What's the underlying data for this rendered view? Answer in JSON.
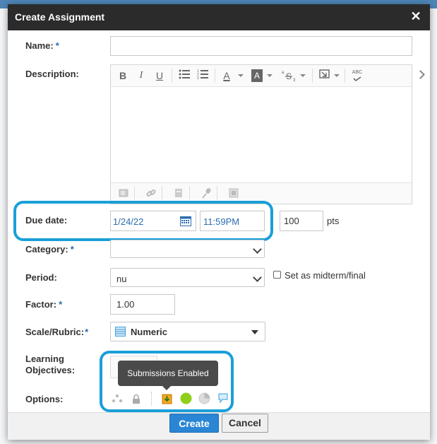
{
  "dialog": {
    "title": "Create Assignment",
    "close_glyph": "✕"
  },
  "form": {
    "name_label": "Name:",
    "description_label": "Description:",
    "due_date_label": "Due date:",
    "category_label": "Category:",
    "period_label": "Period:",
    "factor_label": "Factor:",
    "scale_label": "Scale/Rubric:",
    "objectives_label_line1": "Learning",
    "objectives_label_line2": "Objectives:",
    "options_label": "Options:",
    "required_mark": "*",
    "name_value": "",
    "due_date": "1/24/22",
    "due_time": "11:59PM",
    "points": "100",
    "points_unit": "pts",
    "category_value": "",
    "period_value": "nu",
    "midterm_label": "Set as midterm/final",
    "factor_value": "1.00",
    "scale_value": "Numeric"
  },
  "editor": {
    "toolbar": {
      "bold": "B",
      "italic": "I",
      "underline": "U",
      "font_color": "A",
      "highlight": "A",
      "spellcheck": "ABC"
    }
  },
  "tooltip": {
    "text": "Submissions Enabled"
  },
  "buttons": {
    "create": "Create",
    "cancel": "Cancel"
  },
  "colors": {
    "highlight_ring": "#1a9fd8",
    "primary_button": "#2a86d5",
    "status_green": "#8fce1b"
  }
}
